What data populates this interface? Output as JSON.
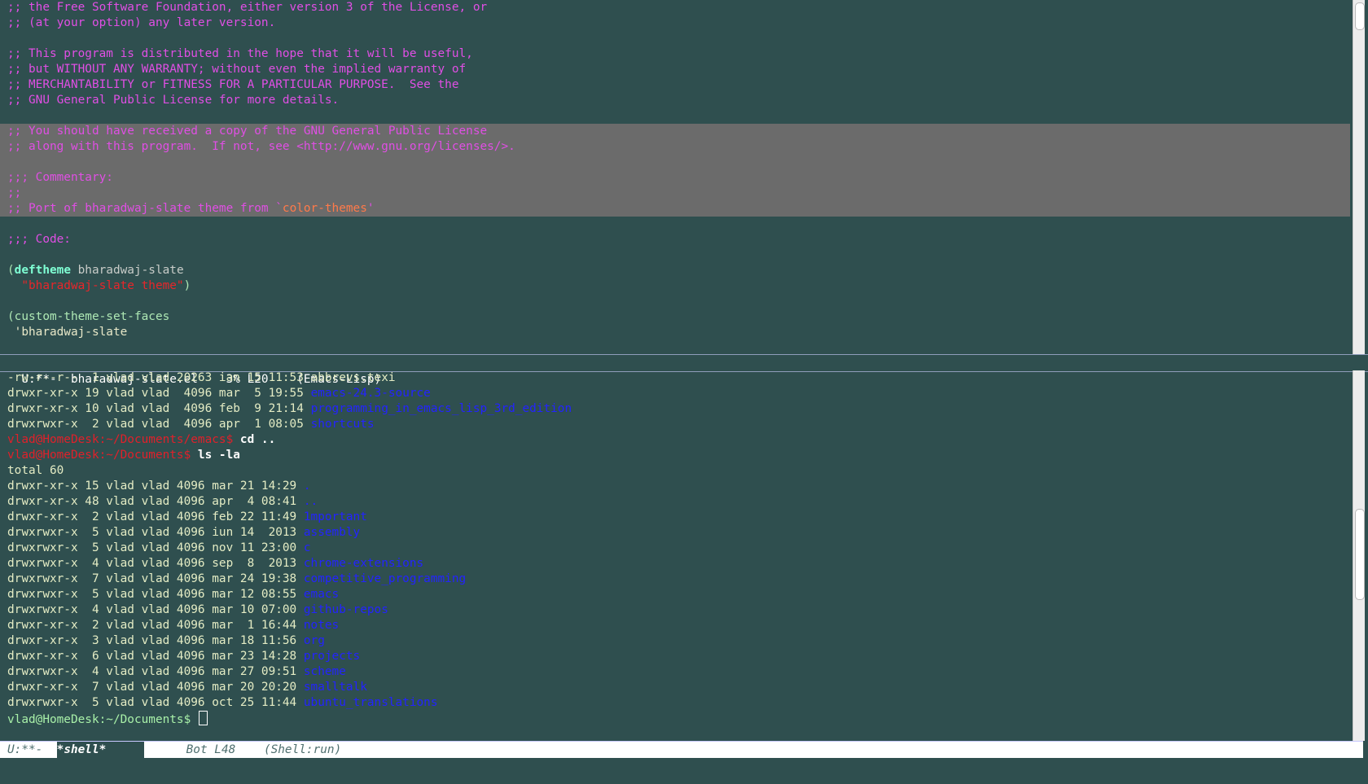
{
  "editor": {
    "lines": [
      {
        "segments": [
          {
            "t": ";; the Free Software Foundation, either version 3 of the License, or",
            "c": "c-comment"
          }
        ]
      },
      {
        "segments": [
          {
            "t": ";; (at your option) any later version.",
            "c": "c-comment"
          }
        ]
      },
      {
        "segments": []
      },
      {
        "segments": [
          {
            "t": ";; This program is distributed in the hope that it will be useful,",
            "c": "c-comment"
          }
        ]
      },
      {
        "segments": [
          {
            "t": ";; but WITHOUT ANY WARRANTY; without even the implied warranty of",
            "c": "c-comment"
          }
        ]
      },
      {
        "segments": [
          {
            "t": ";; MERCHANTABILITY or FITNESS FOR A PARTICULAR PURPOSE.  See the",
            "c": "c-comment"
          }
        ]
      },
      {
        "segments": [
          {
            "t": ";; GNU General Public License for more details.",
            "c": "c-comment"
          }
        ]
      },
      {
        "segments": []
      },
      {
        "region": true,
        "segments": [
          {
            "t": ";; You should have received a copy of the GNU General Public License",
            "c": "c-comment"
          }
        ]
      },
      {
        "region": true,
        "segments": [
          {
            "t": ";; along with this program.  If not, see <http://www.gnu.org/licenses/>.",
            "c": "c-comment"
          }
        ]
      },
      {
        "region": true,
        "segments": []
      },
      {
        "region": true,
        "segments": [
          {
            "t": ";;; Commentary:",
            "c": "c-comment"
          }
        ]
      },
      {
        "region": true,
        "segments": [
          {
            "t": ";;",
            "c": "c-comment"
          }
        ]
      },
      {
        "region": true,
        "segments": [
          {
            "t": ";; Port of bharadwaj-slate theme from `",
            "c": "c-comment"
          },
          {
            "t": "color-themes",
            "c": "c-const"
          },
          {
            "t": "'",
            "c": "c-comment"
          }
        ]
      },
      {
        "segments": []
      },
      {
        "segments": [
          {
            "t": ";;; Code:",
            "c": "c-comment"
          }
        ]
      },
      {
        "segments": []
      },
      {
        "segments": [
          {
            "t": "(",
            "c": "c-paren"
          },
          {
            "t": "deftheme",
            "c": "c-kw"
          },
          {
            "t": " bharadwaj-slate",
            "c": "c-name"
          }
        ]
      },
      {
        "segments": [
          {
            "t": "  ",
            "c": "c-paren"
          },
          {
            "t": "\"bharadwaj-slate theme\"",
            "c": "c-str"
          },
          {
            "t": ")",
            "c": "c-paren"
          }
        ]
      },
      {
        "segments": []
      },
      {
        "segments": [
          {
            "t": "(custom-theme-set-faces",
            "c": "c-paren"
          }
        ]
      },
      {
        "segments": [
          {
            "t": " 'bharadwaj-slate",
            "c": "c-quote"
          }
        ]
      }
    ]
  },
  "modeline_top": {
    "text": "U:**-  bharadwaj-slate.el    3% L20    (Emacs-Lisp)"
  },
  "shell": {
    "lines": [
      {
        "segments": [
          {
            "t": "-rw-r--r--  1 vlad vlad 20263 ian 15 11:53 ",
            "c": "c-ls"
          },
          {
            "t": "abbrevs.texi",
            "c": "c-ls"
          }
        ]
      },
      {
        "segments": [
          {
            "t": "drwxr-xr-x 19 vlad vlad  4096 mar  5 19:55 ",
            "c": "c-ls"
          },
          {
            "t": "emacs-24.3-source",
            "c": "c-dir"
          }
        ]
      },
      {
        "segments": [
          {
            "t": "drwxr-xr-x 10 vlad vlad  4096 feb  9 21:14 ",
            "c": "c-ls"
          },
          {
            "t": "programming_in_emacs_lisp_3rd_edition",
            "c": "c-dir"
          }
        ]
      },
      {
        "segments": [
          {
            "t": "drwxrwxr-x  2 vlad vlad  4096 apr  1 08:05 ",
            "c": "c-ls"
          },
          {
            "t": "shortcuts",
            "c": "c-dir"
          }
        ]
      },
      {
        "segments": [
          {
            "t": "vlad@HomeDesk:~/Documents/emacs$",
            "c": "c-prompt-old"
          },
          {
            "t": " cd ..",
            "c": "c-cmd"
          }
        ]
      },
      {
        "segments": [
          {
            "t": "vlad@HomeDesk:~/Documents$",
            "c": "c-prompt-old"
          },
          {
            "t": " ls -la",
            "c": "c-cmd"
          }
        ]
      },
      {
        "segments": [
          {
            "t": "total 60",
            "c": "c-ls"
          }
        ]
      },
      {
        "segments": [
          {
            "t": "drwxr-xr-x 15 vlad vlad 4096 mar 21 14:29 ",
            "c": "c-ls"
          },
          {
            "t": ".",
            "c": "c-dir"
          }
        ]
      },
      {
        "segments": [
          {
            "t": "drwxr-xr-x 48 vlad vlad 4096 apr  4 08:41 ",
            "c": "c-ls"
          },
          {
            "t": "..",
            "c": "c-dir"
          }
        ]
      },
      {
        "segments": [
          {
            "t": "drwxr-xr-x  2 vlad vlad 4096 feb 22 11:49 ",
            "c": "c-ls"
          },
          {
            "t": "1mportant",
            "c": "c-dir"
          }
        ]
      },
      {
        "segments": [
          {
            "t": "drwxrwxr-x  5 vlad vlad 4096 iun 14  2013 ",
            "c": "c-ls"
          },
          {
            "t": "assembly",
            "c": "c-dir"
          }
        ]
      },
      {
        "segments": [
          {
            "t": "drwxrwxr-x  5 vlad vlad 4096 nov 11 23:00 ",
            "c": "c-ls"
          },
          {
            "t": "c",
            "c": "c-dir"
          }
        ]
      },
      {
        "segments": [
          {
            "t": "drwxrwxr-x  4 vlad vlad 4096 sep  8  2013 ",
            "c": "c-ls"
          },
          {
            "t": "chrome-extensions",
            "c": "c-dir"
          }
        ]
      },
      {
        "segments": [
          {
            "t": "drwxrwxr-x  7 vlad vlad 4096 mar 24 19:38 ",
            "c": "c-ls"
          },
          {
            "t": "competitive_programming",
            "c": "c-dir"
          }
        ]
      },
      {
        "segments": [
          {
            "t": "drwxrwxr-x  5 vlad vlad 4096 mar 12 08:55 ",
            "c": "c-ls"
          },
          {
            "t": "emacs",
            "c": "c-dir"
          }
        ]
      },
      {
        "segments": [
          {
            "t": "drwxrwxr-x  4 vlad vlad 4096 mar 10 07:00 ",
            "c": "c-ls"
          },
          {
            "t": "github-repos",
            "c": "c-dir"
          }
        ]
      },
      {
        "segments": [
          {
            "t": "drwxr-xr-x  2 vlad vlad 4096 mar  1 16:44 ",
            "c": "c-ls"
          },
          {
            "t": "notes",
            "c": "c-dir"
          }
        ]
      },
      {
        "segments": [
          {
            "t": "drwxr-xr-x  3 vlad vlad 4096 mar 18 11:56 ",
            "c": "c-ls"
          },
          {
            "t": "org",
            "c": "c-dir"
          }
        ]
      },
      {
        "segments": [
          {
            "t": "drwxr-xr-x  6 vlad vlad 4096 mar 23 14:28 ",
            "c": "c-ls"
          },
          {
            "t": "projects",
            "c": "c-dir"
          }
        ]
      },
      {
        "segments": [
          {
            "t": "drwxrwxr-x  4 vlad vlad 4096 mar 27 09:51 ",
            "c": "c-ls"
          },
          {
            "t": "scheme",
            "c": "c-dir"
          }
        ]
      },
      {
        "segments": [
          {
            "t": "drwxr-xr-x  7 vlad vlad 4096 mar 20 20:20 ",
            "c": "c-ls"
          },
          {
            "t": "smalltalk",
            "c": "c-dir"
          }
        ]
      },
      {
        "segments": [
          {
            "t": "drwxrwxr-x  5 vlad vlad 4096 oct 25 11:44 ",
            "c": "c-ls"
          },
          {
            "t": "ubuntu_translations",
            "c": "c-dir"
          }
        ]
      },
      {
        "prompt": true,
        "segments": [
          {
            "t": "vlad@HomeDesk:~/Documents$ ",
            "c": "c-prompt"
          }
        ]
      }
    ]
  },
  "modeline_bottom": {
    "left": "U:**-  ",
    "buffer": "*shell*",
    "right": "      Bot L48    (Shell:run)"
  },
  "colors": {
    "background": "#2f4f4f",
    "comment": "#e04fe4",
    "string": "#e8262a",
    "keyword": "#7fffd4",
    "directory": "#2323ff",
    "region": "#6b6b6b"
  }
}
